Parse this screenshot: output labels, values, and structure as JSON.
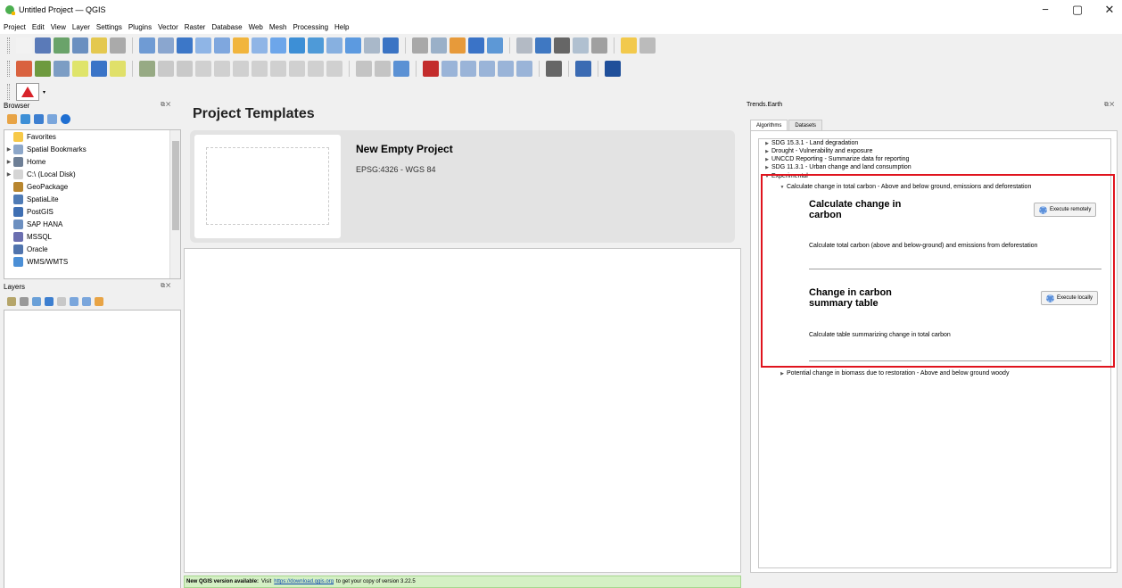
{
  "window": {
    "title": "Untitled Project — QGIS",
    "controls": [
      "−",
      "▢",
      "✕"
    ]
  },
  "menu": [
    "Project",
    "Edit",
    "View",
    "Layer",
    "Settings",
    "Plugins",
    "Vector",
    "Raster",
    "Database",
    "Web",
    "Mesh",
    "Processing",
    "Help"
  ],
  "toolbar1_colors": [
    "#f2f2f2",
    "#5a7ab8",
    "#6aa36a",
    "#6a8fc0",
    "#e4c84f",
    "#aaaaaa",
    "#6f9bd4",
    "#8aa6cf",
    "#3c77c8",
    "#8fb5e6",
    "#7fa7de",
    "#f1b53d",
    "#8fb5e6",
    "#6da6ea",
    "#3d8fd6",
    "#4e9ad8",
    "#87b0e0",
    "#5c9ae0",
    "#a9b8c9",
    "#3b74c4",
    "#a8a8a8",
    "#9ab0c8",
    "#e79a3a",
    "#3a73c7",
    "#5d98d6",
    "#b3bac4",
    "#3f78c2",
    "#666666",
    "#b0c0d0",
    "#a0a0a0",
    "#f2c94c",
    "#bbbbbb"
  ],
  "toolbar2_colors": [
    "#d9623f",
    "#6e9a3f",
    "#7c9dc4",
    "#dfe46a",
    "#3a74c7",
    "#e0e06a",
    "#97aa84",
    "#c9c9c9",
    "#c9c9c9",
    "#d0d0d0",
    "#d0d0d0",
    "#d0d0d0",
    "#d0d0d0",
    "#d0d0d0",
    "#d0d0d0",
    "#d0d0d0",
    "#d0d0d0",
    "#c4c4c4",
    "#c4c4c4",
    "#5b91d4",
    "#c32c2c",
    "#9ab4d8",
    "#9ab4d8",
    "#9ab4d8",
    "#9ab4d8",
    "#9ab4d8",
    "#666666",
    "#3b6bb3",
    "#1f4f9a"
  ],
  "browser": {
    "title": "Browser",
    "items": [
      {
        "label": "Favorites",
        "icon": "star-icon",
        "color": "#f7c948",
        "arrow": ""
      },
      {
        "label": "Spatial Bookmarks",
        "icon": "bookmark-icon",
        "color": "#8da7c9",
        "arrow": "▶"
      },
      {
        "label": "Home",
        "icon": "home-icon",
        "color": "#6e7f96",
        "arrow": "▶"
      },
      {
        "label": "C:\\ (Local Disk)",
        "icon": "disk-icon",
        "color": "#d5d5d5",
        "arrow": "▶"
      },
      {
        "label": "GeoPackage",
        "icon": "geopackage-icon",
        "color": "#b8862f",
        "arrow": ""
      },
      {
        "label": "SpatiaLite",
        "icon": "spatialite-icon",
        "color": "#4f7bb5",
        "arrow": ""
      },
      {
        "label": "PostGIS",
        "icon": "postgis-icon",
        "color": "#3f6fb3",
        "arrow": ""
      },
      {
        "label": "SAP HANA",
        "icon": "sap-hana-icon",
        "color": "#6c8fc0",
        "arrow": ""
      },
      {
        "label": "MSSQL",
        "icon": "mssql-icon",
        "color": "#6b6fb0",
        "arrow": ""
      },
      {
        "label": "Oracle",
        "icon": "oracle-icon",
        "color": "#5074ad",
        "arrow": ""
      },
      {
        "label": "WMS/WMTS",
        "icon": "wms-icon",
        "color": "#4b8fd6",
        "arrow": ""
      }
    ]
  },
  "layers": {
    "title": "Layers"
  },
  "center": {
    "title": "Project Templates",
    "template": {
      "name": "New Empty Project",
      "crs": "EPSG:4326 - WGS 84"
    },
    "notice": {
      "bold": "New QGIS version available:",
      "pre": "Visit",
      "link": "https://download.qgis.org",
      "post": "to get your copy of version 3.22.5"
    }
  },
  "trends": {
    "title": "Trends.Earth",
    "tabs": [
      "Algorithms",
      "Datasets"
    ],
    "tree": [
      "SDG 15.3.1 - Land degradation",
      "Drought - Vulnerability and exposure",
      "UNCCD Reporting - Summarize data for reporting",
      "SDG 11.3.1 - Urban change and land consumption",
      "Experimental",
      "Calculate change in total carbon - Above and below ground, emissions and deforestation",
      "Potential change in biomass due to restoration - Above and below ground woody"
    ],
    "algorithms": [
      {
        "title": "Calculate change in carbon",
        "desc": "Calculate total carbon (above and below-ground) and emissions from deforestation",
        "button": "Execute remotely"
      },
      {
        "title": "Change in carbon summary table",
        "desc": "Calculate table summarizing change in total carbon",
        "button": "Execute locally"
      }
    ]
  },
  "highlight_color": "#e0141e"
}
